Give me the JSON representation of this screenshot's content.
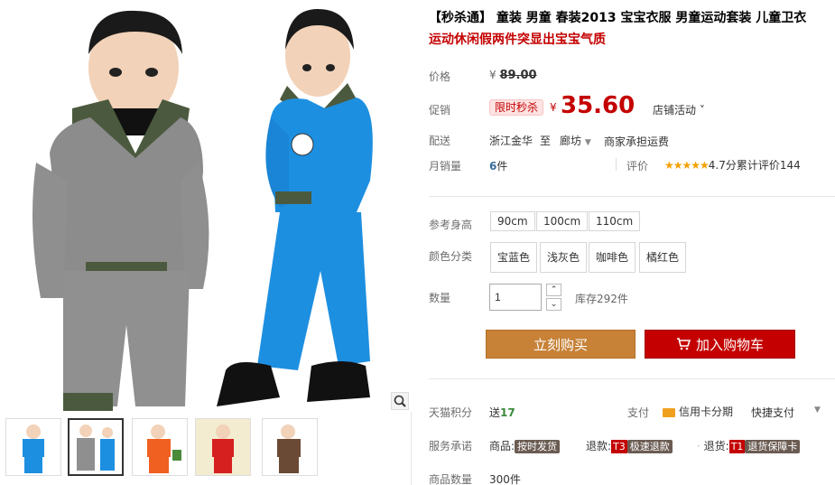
{
  "gallery": {
    "thumbnails": [
      "thumb-blue-boy",
      "thumb-grey-blue-pair",
      "thumb-orange",
      "thumb-red",
      "thumb-brown"
    ]
  },
  "product": {
    "title": "【秒杀通】 童装 男童 春装2013 宝宝衣服 男童运动套装 儿童卫衣",
    "subtitle": "运动休闲假两件突显出宝宝气质",
    "price_label": "价格",
    "original_price": "89.00",
    "currency": "¥",
    "promo_label": "促销",
    "promo_badge": "限时秒杀",
    "promo_price": "35.60",
    "shop_activity": "店铺活动",
    "shipping_label": "配送",
    "ship_from": "浙江金华",
    "ship_to_word": "至",
    "ship_to": "廊坊",
    "ship_fee": "商家承担运费",
    "monthly_sales_label": "月销量",
    "monthly_sales_value": "6",
    "monthly_sales_unit": "件",
    "rating_label": "评价",
    "rating_text": "4.7分",
    "rating_count_text": "累计评价144",
    "rating_value": 4.7,
    "height_label": "参考身高",
    "heights": [
      "90cm",
      "100cm",
      "110cm"
    ],
    "color_label": "颜色分类",
    "colors": [
      "宝蓝色",
      "浅灰色",
      "咖啡色",
      "橘红色"
    ],
    "qty_label": "数量",
    "qty_value": "1",
    "stock": "库存292件",
    "buy_now": "立刻购买",
    "add_to_cart": "加入购物车",
    "points_label": "天猫积分",
    "points_prefix": "送",
    "points_value": "17",
    "pay_label": "支付",
    "pay_credit": "信用卡分期",
    "pay_quick": "快捷支付",
    "service_label": "服务承诺",
    "service_goods": "商品:",
    "service_goods_tag": "按时发货",
    "service_refund": "退款:",
    "service_refund_code": "T3",
    "service_refund_tag": "极速退款",
    "service_return": "退货:",
    "service_return_code": "T1",
    "service_return_tag": "退货保障卡",
    "count_label": "商品数量",
    "count_value": "300件"
  },
  "colors": {
    "accent": "#c40000",
    "buy": "#c78238",
    "rating": "#f4a000"
  }
}
